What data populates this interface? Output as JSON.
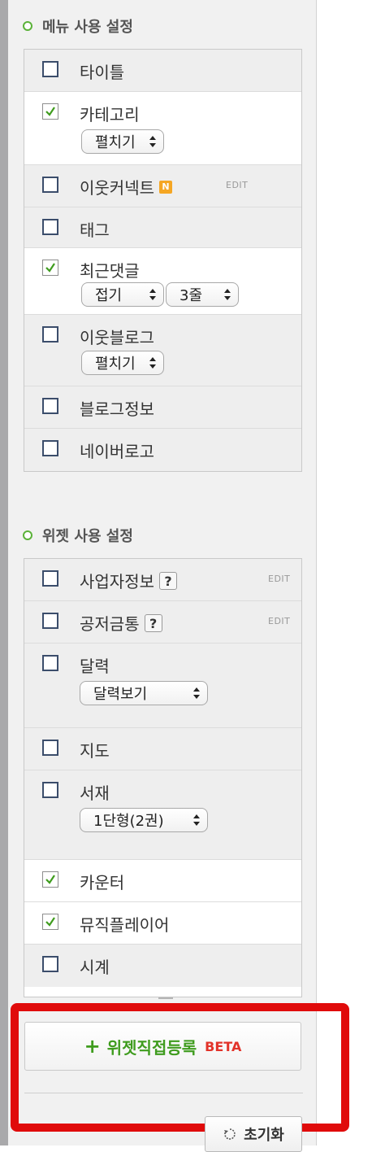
{
  "menu_section": {
    "title": "메뉴 사용 설정",
    "items": [
      {
        "label": "타이틀",
        "checked": false
      },
      {
        "label": "카테고리",
        "checked": true,
        "select": "펼치기"
      },
      {
        "label": "이웃커넥트",
        "checked": false,
        "badge": "N",
        "edit": "EDIT"
      },
      {
        "label": "태그",
        "checked": false
      },
      {
        "label": "최근댓글",
        "checked": true,
        "select": "접기",
        "select2": "3줄"
      },
      {
        "label": "이웃블로그",
        "checked": false,
        "select": "펼치기"
      },
      {
        "label": "블로그정보",
        "checked": false
      },
      {
        "label": "네이버로고",
        "checked": false
      }
    ]
  },
  "widget_section": {
    "title": "위젯 사용 설정",
    "items": [
      {
        "label": "사업자정보",
        "checked": false,
        "help": "?",
        "edit": "EDIT"
      },
      {
        "label": "공저금통",
        "checked": false,
        "help": "?",
        "edit": "EDIT"
      },
      {
        "label": "달력",
        "checked": false,
        "select": "달력보기"
      },
      {
        "label": "지도",
        "checked": false
      },
      {
        "label": "서재",
        "checked": false,
        "select": "1단형(2권)"
      },
      {
        "label": "카운터",
        "checked": true
      },
      {
        "label": "뮤직플레이어",
        "checked": true
      },
      {
        "label": "시계",
        "checked": false
      }
    ]
  },
  "add_widget": {
    "plus": "+",
    "label": "위젯직접등록",
    "beta": "BETA"
  },
  "reset": {
    "label": "초기화"
  },
  "colors": {
    "accent_green": "#3f9c1e",
    "beta_red": "#e2332a",
    "highlight_red": "#e00b0b"
  },
  "icons": [
    "checkbox-icon",
    "check-icon",
    "help-icon",
    "new-badge-icon",
    "plus-icon",
    "reset-icon",
    "select-arrows-icon"
  ]
}
